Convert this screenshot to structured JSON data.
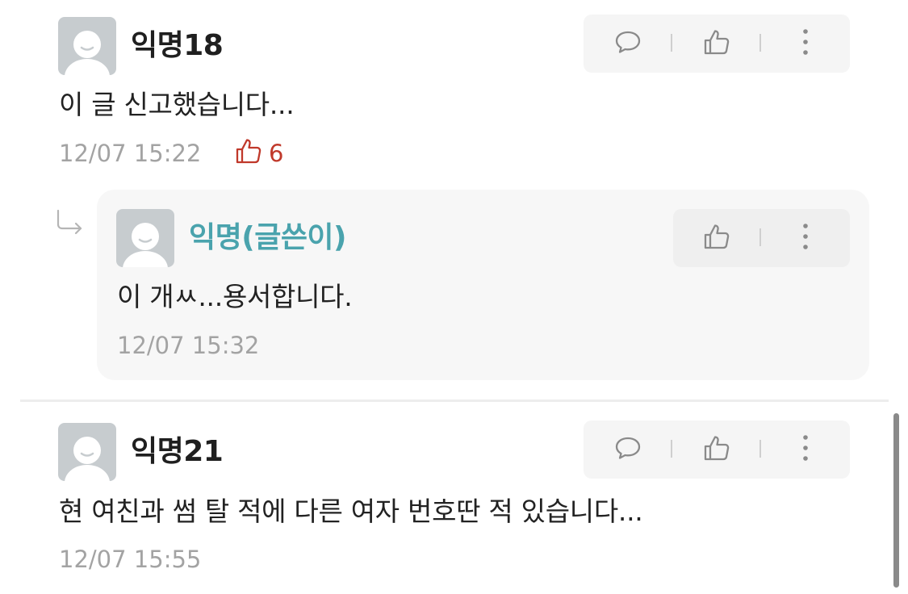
{
  "comments": [
    {
      "nickname": "익명18",
      "body": "이 글 신고했습니다...",
      "timestamp": "12/07 15:22",
      "likes": "6",
      "icons": [
        "comment-icon",
        "thumbs-up-icon",
        "more-vertical-icon"
      ]
    },
    {
      "nickname": "익명21",
      "body": "현 여친과 썸 탈 적에 다른 여자 번호딴 적 있습니다...",
      "timestamp": "12/07 15:55",
      "icons": [
        "comment-icon",
        "thumbs-up-icon",
        "more-vertical-icon"
      ]
    }
  ],
  "reply": {
    "nickname": "익명(글쓴이)",
    "body": "이 개ㅆ...용서합니다.",
    "timestamp": "12/07 15:32",
    "icons": [
      "reply-arrow-icon",
      "thumbs-up-icon",
      "more-vertical-icon"
    ]
  },
  "colors": {
    "author_nickname": "#4aa3ad",
    "likes": "#c0392b",
    "meta": "#a3a3a3",
    "action_bg": "#f5f5f5",
    "reply_bg": "#f7f7f7"
  }
}
